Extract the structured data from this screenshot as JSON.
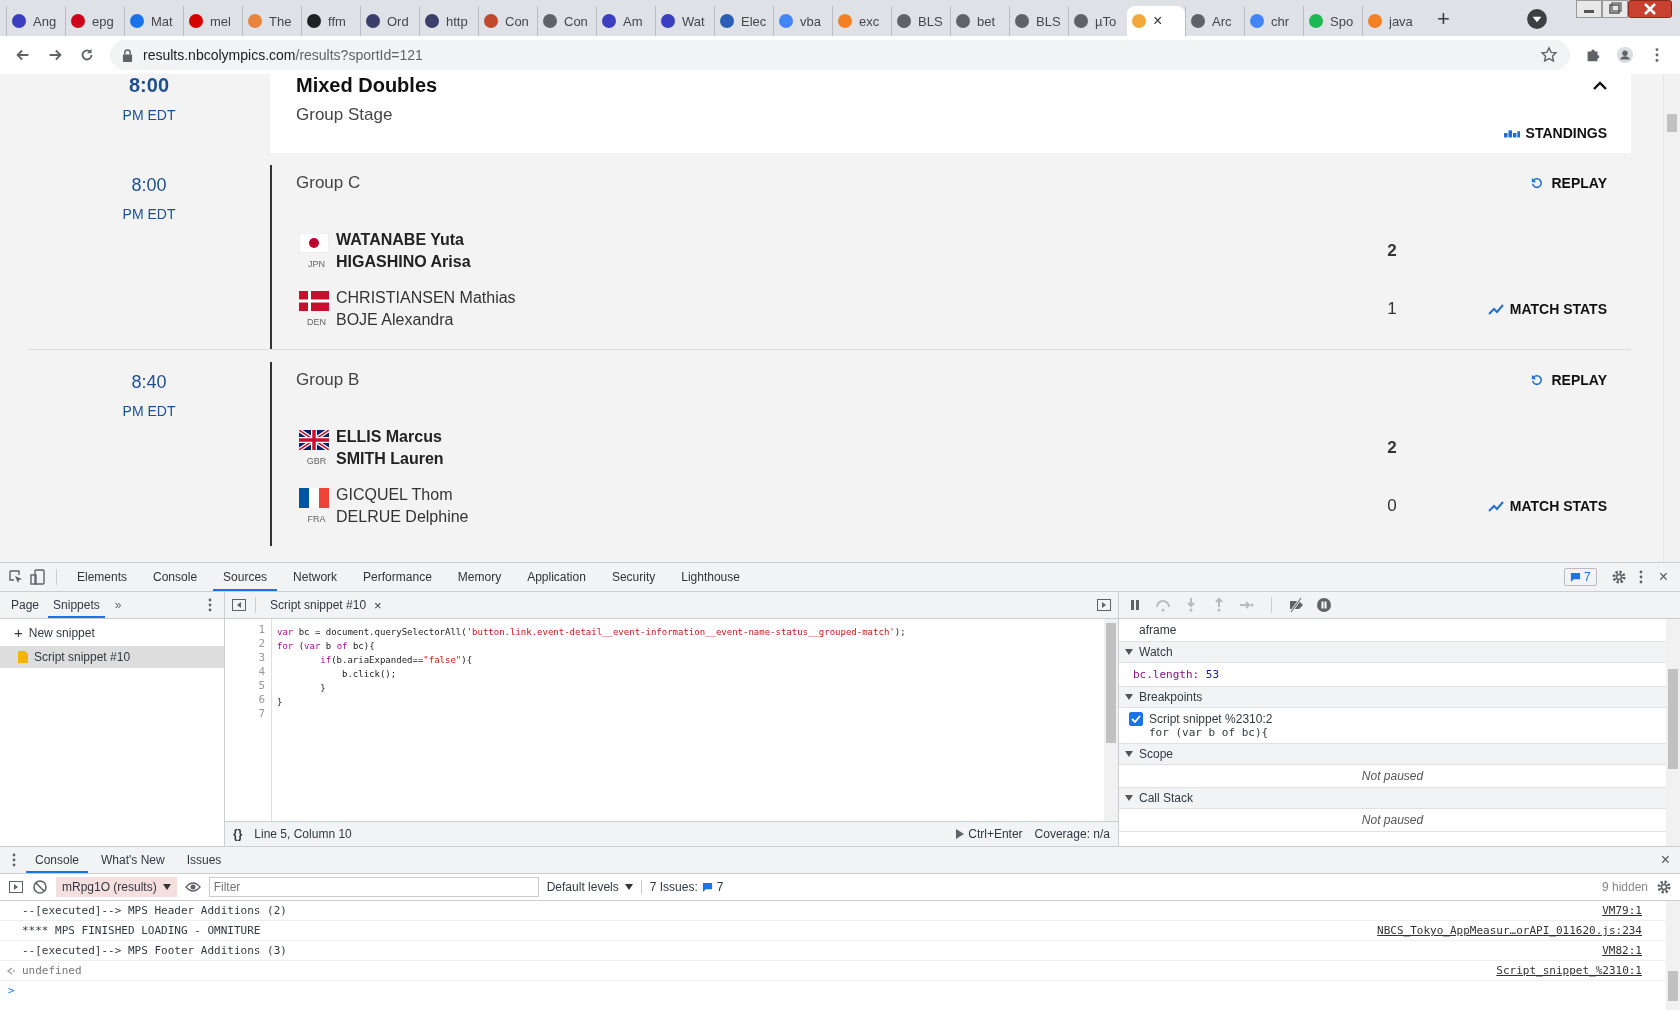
{
  "browser": {
    "tabs": [
      {
        "label": "Ang",
        "color": "#3b3fbf",
        "selected": false
      },
      {
        "label": "epg",
        "color": "#d0021b",
        "selected": false
      },
      {
        "label": "Mat",
        "color": "#1a73e8",
        "selected": false
      },
      {
        "label": "mel",
        "color": "#d50000",
        "selected": false
      },
      {
        "label": "The",
        "color": "#e8843c",
        "selected": false
      },
      {
        "label": "ffm",
        "color": "#202124",
        "selected": false
      },
      {
        "label": "Ord",
        "color": "#3c3f6b",
        "selected": false
      },
      {
        "label": "http",
        "color": "#3c3f6b",
        "selected": false
      },
      {
        "label": "Con",
        "color": "#c0482d",
        "selected": false
      },
      {
        "label": "Con",
        "color": "#5f6368",
        "selected": false
      },
      {
        "label": "Am",
        "color": "#3b3fbf",
        "selected": false
      },
      {
        "label": "Wat",
        "color": "#3b3fbf",
        "selected": false
      },
      {
        "label": "Elec",
        "color": "#2b5fb3",
        "selected": false
      },
      {
        "label": "vba",
        "color": "#4285f4",
        "selected": false
      },
      {
        "label": "exc",
        "color": "#f48024",
        "selected": false
      },
      {
        "label": "BLS",
        "color": "#5f6368",
        "selected": false
      },
      {
        "label": "bet",
        "color": "#5f6368",
        "selected": false
      },
      {
        "label": "BLS",
        "color": "#5f6368",
        "selected": false
      },
      {
        "label": "µTo",
        "color": "#5f6368",
        "selected": false
      },
      {
        "color": "#f2a93b",
        "selected": true
      },
      {
        "label": "Arc",
        "color": "#5f6368",
        "selected": false
      },
      {
        "label": "chr",
        "color": "#4285f4",
        "selected": false
      },
      {
        "label": "Spo",
        "color": "#1db954",
        "selected": false
      },
      {
        "label": "java",
        "color": "#f48024",
        "selected": false
      }
    ],
    "tab_close": "×",
    "new_tab": "+",
    "url_host": "results.nbcolympics.com",
    "url_path": "/results?sportId=121"
  },
  "page": {
    "rows": [
      {
        "kind": "event",
        "time": "8:00",
        "zone": "PM EDT",
        "title": "Mixed Doubles",
        "subtitle": "Group Stage",
        "expanded": true,
        "action": "STANDINGS"
      },
      {
        "kind": "match",
        "time": "8:00",
        "zone": "PM EDT",
        "title": "Group C",
        "action": "REPLAY",
        "stats": "MATCH STATS",
        "teams": [
          {
            "kind": "jp",
            "code": "JPN",
            "players": [
              "WATANABE Yuta",
              "HIGASHINO Arisa"
            ],
            "score": "2",
            "winner": true
          },
          {
            "kind": "dk",
            "code": "DEN",
            "players": [
              "CHRISTIANSEN Mathias",
              "BOJE Alexandra"
            ],
            "score": "1",
            "winner": false
          }
        ]
      },
      {
        "kind": "match",
        "time": "8:40",
        "zone": "PM EDT",
        "title": "Group B",
        "action": "REPLAY",
        "stats": "MATCH STATS",
        "teams": [
          {
            "kind": "gb",
            "code": "GBR",
            "players": [
              "ELLIS Marcus",
              "SMITH Lauren"
            ],
            "score": "2",
            "winner": true
          },
          {
            "kind": "fr",
            "code": "FRA",
            "players": [
              "GICQUEL Thom",
              "DELRUE Delphine"
            ],
            "score": "0",
            "winner": false
          }
        ]
      }
    ]
  },
  "devtools": {
    "tabs": [
      {
        "label": "Elements",
        "selected": false
      },
      {
        "label": "Console",
        "selected": false
      },
      {
        "label": "Sources",
        "selected": true
      },
      {
        "label": "Network",
        "selected": false
      },
      {
        "label": "Performance",
        "selected": false
      },
      {
        "label": "Memory",
        "selected": false
      },
      {
        "label": "Application",
        "selected": false
      },
      {
        "label": "Security",
        "selected": false
      },
      {
        "label": "Lighthouse",
        "selected": false
      }
    ],
    "issues_badge": "7",
    "close": "×",
    "navigator": {
      "tabs": [
        {
          "label": "Page",
          "selected": false
        },
        {
          "label": "Snippets",
          "selected": true
        }
      ],
      "more": "»",
      "new_snippet": "New snippet",
      "new_icon": "+",
      "items": [
        {
          "label": "Script snippet #10",
          "selected": true
        }
      ]
    },
    "editor": {
      "tab": "Script snippet #10",
      "tab_close": "×",
      "lines": [
        {
          "number": "1",
          "tokens": [
            {
              "kind": "kw",
              "text": "var"
            },
            {
              "kind": "plain",
              "text": " bc = document.querySelectorAll("
            },
            {
              "kind": "str",
              "text": "'button.link.event-detail__event-information__event-name-status__grouped-match'"
            },
            {
              "kind": "plain",
              "text": ");"
            }
          ]
        },
        {
          "number": "2",
          "tokens": [
            {
              "kind": "kw",
              "text": "for"
            },
            {
              "kind": "plain",
              "text": " ("
            },
            {
              "kind": "kw",
              "text": "var"
            },
            {
              "kind": "plain",
              "text": " b "
            },
            {
              "kind": "kw",
              "text": "of"
            },
            {
              "kind": "plain",
              "text": " bc){"
            }
          ]
        },
        {
          "number": "3",
          "tokens": [
            {
              "kind": "kw",
              "text": "        if"
            },
            {
              "kind": "plain",
              "text": "(b.ariaExpanded=="
            },
            {
              "kind": "str",
              "text": "\"false\""
            },
            {
              "kind": "plain",
              "text": "){"
            }
          ]
        },
        {
          "number": "4",
          "tokens": [
            {
              "kind": "plain",
              "text": "            b.click();"
            }
          ]
        },
        {
          "number": "5",
          "tokens": [
            {
              "kind": "plain",
              "text": "        }"
            }
          ]
        },
        {
          "number": "6",
          "tokens": [
            {
              "kind": "plain",
              "text": "}"
            }
          ]
        },
        {
          "number": "7"
        }
      ],
      "format": "{}",
      "position": "Line 5, Column 10",
      "run": "Ctrl+Enter",
      "coverage": "Coverage: n/a"
    },
    "debugger": {
      "expression": "aframe",
      "sections": [
        {
          "kind": "watch",
          "title": "Watch",
          "expanded": true,
          "entries": [
            {
              "name": "bc.length:",
              "value": "53"
            }
          ]
        },
        {
          "kind": "breakpoints",
          "title": "Breakpoints",
          "expanded": true,
          "entries": [
            {
              "label": "Script snippet %2310:2",
              "code": "for (var b of bc){",
              "checked": true
            }
          ]
        },
        {
          "kind": "empty",
          "title": "Scope",
          "expanded": true,
          "message": "Not paused"
        },
        {
          "kind": "empty",
          "title": "Call Stack",
          "expanded": true,
          "message": "Not paused"
        }
      ]
    },
    "drawer": {
      "tabs": [
        {
          "label": "Console",
          "selected": true
        },
        {
          "label": "What's New",
          "selected": false
        },
        {
          "label": "Issues",
          "selected": false
        }
      ],
      "close": "×",
      "context": "mRpg1O (results)",
      "filter_placeholder": "Filter",
      "levels": "Default levels",
      "issues_label": "7 Issues:",
      "issues_count": "7",
      "hidden": "9 hidden",
      "messages": [
        {
          "kind": "log",
          "text": "--[executed]--> MPS Header Additions (2)",
          "source": "VM79:1"
        },
        {
          "kind": "log",
          "text": "**** MPS FINISHED LOADING - OMNITURE",
          "source": "NBCS_Tokyo_AppMeasur…orAPI_011620.js:234"
        },
        {
          "kind": "log",
          "text": "--[executed]--> MPS Footer Additions (3)",
          "source": "VM82:1"
        },
        {
          "kind": "result",
          "text": "undefined",
          "source": "Script_snippet_%2310:1"
        }
      ],
      "prompt": ">"
    }
  }
}
